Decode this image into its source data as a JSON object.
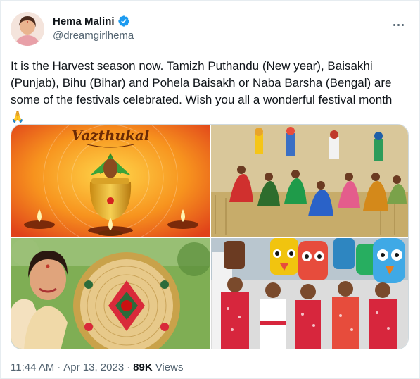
{
  "author": {
    "display_name": "Hema Malini",
    "handle": "@dreamgirlhema",
    "verified": true
  },
  "tweet": {
    "text": "It is the Harvest season now. Tamizh Puthandu (New year), Baisakhi (Punjab), Bihu (Bihar) and Pohela Baisakh or Naba Barsha (Bengal) are some of the festivals celebrated. Wish you all a wonderful festival month",
    "emoji": "🙏"
  },
  "media": {
    "images": [
      {
        "caption_text": "Vazthukal"
      },
      {},
      {},
      {}
    ]
  },
  "meta": {
    "time": "11:44 AM",
    "separator1": "·",
    "date": "Apr 13, 2023",
    "separator2": "·",
    "views_count": "89K",
    "views_label": "Views"
  },
  "colors": {
    "verified_blue": "#1d9bf0",
    "secondary_text": "#536471",
    "primary_text": "#0f1419"
  }
}
